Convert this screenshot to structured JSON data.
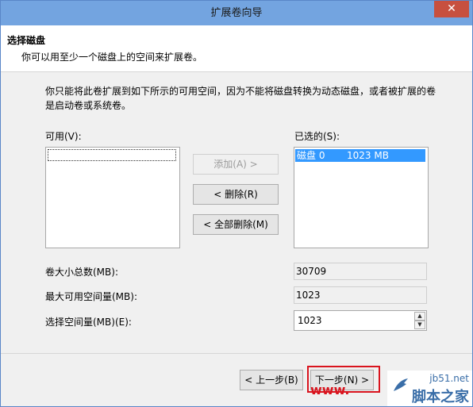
{
  "window": {
    "title": "扩展卷向导",
    "close_glyph": "✕"
  },
  "header": {
    "title": "选择磁盘",
    "subtitle": "你可以用至少一个磁盘上的空间来扩展卷。"
  },
  "description": {
    "line1": "你只能将此卷扩展到如下所示的可用空间，因为不能将磁盘转换为动态磁盘，或者被扩展的卷",
    "line2": "是启动卷或系统卷。"
  },
  "available": {
    "label": "可用(V):"
  },
  "selected": {
    "label": "已选的(S):",
    "items": [
      {
        "disk": "磁盘 0",
        "size": "1023 MB"
      }
    ]
  },
  "buttons": {
    "add": "添加(A) >",
    "remove": "< 删除(R)",
    "remove_all": "< 全部删除(M)",
    "back": "< 上一步(B)",
    "next": "下一步(N) >"
  },
  "fields": {
    "total_label": "卷大小总数(MB):",
    "total_value": "30709",
    "max_label": "最大可用空间量(MB):",
    "max_value": "1023",
    "select_label": "选择空间量(MB)(E):",
    "select_value": "1023"
  },
  "watermark": {
    "overlay_text": "www.",
    "site": "jb51.net",
    "brand": "脚本之家"
  },
  "colors": {
    "titlebar": "#73a4e0",
    "selection": "#3399ff",
    "highlight": "#d9141e"
  }
}
